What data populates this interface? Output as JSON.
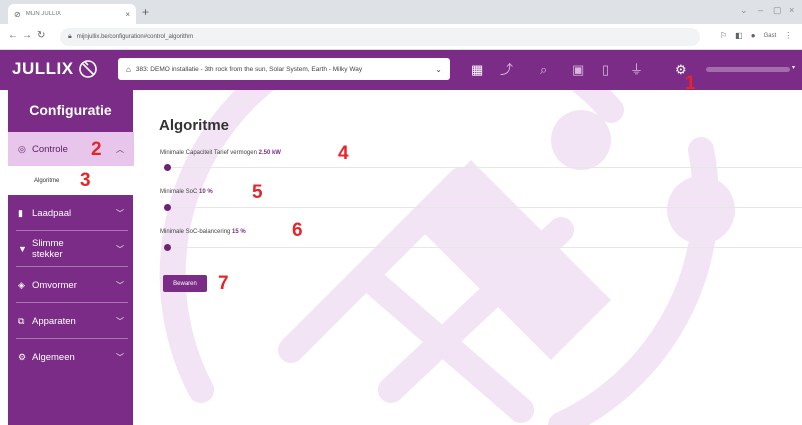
{
  "browser": {
    "tab_title": "MIJN JULLIX",
    "url": "mijnjullix.be/configuration#control_algorithm",
    "profile": "Gast"
  },
  "header": {
    "logo": "JULLIX",
    "installer": "383: DEMO installatie - 3th rock from the sun, Solar System, Earth - Milky Way"
  },
  "sidebar": {
    "title": "Configuratie",
    "items": [
      {
        "label": "Controle"
      },
      {
        "label": "Laadpaal"
      },
      {
        "label": "Slimme stekker"
      },
      {
        "label": "Omvormer"
      },
      {
        "label": "Apparaten"
      },
      {
        "label": "Algemeen"
      }
    ],
    "sub_item": "Algoritme"
  },
  "main": {
    "title": "Algoritme",
    "settings": [
      {
        "label": "Minimale Capaciteit Tarief vermogen",
        "value": "2.50 kW",
        "level": 0
      },
      {
        "label": "Minimale SoC",
        "value": "10 %",
        "level": 0
      },
      {
        "label": "Minimale SoC-balancering",
        "value": "15 %",
        "level": 0
      }
    ],
    "save_label": "Bewaren"
  },
  "annotations": [
    "1",
    "2",
    "3",
    "4",
    "5",
    "6",
    "7"
  ],
  "colors": {
    "brand": "#7b2c86",
    "active_item": "#e8c6ec",
    "annotation": "#e8242a"
  }
}
